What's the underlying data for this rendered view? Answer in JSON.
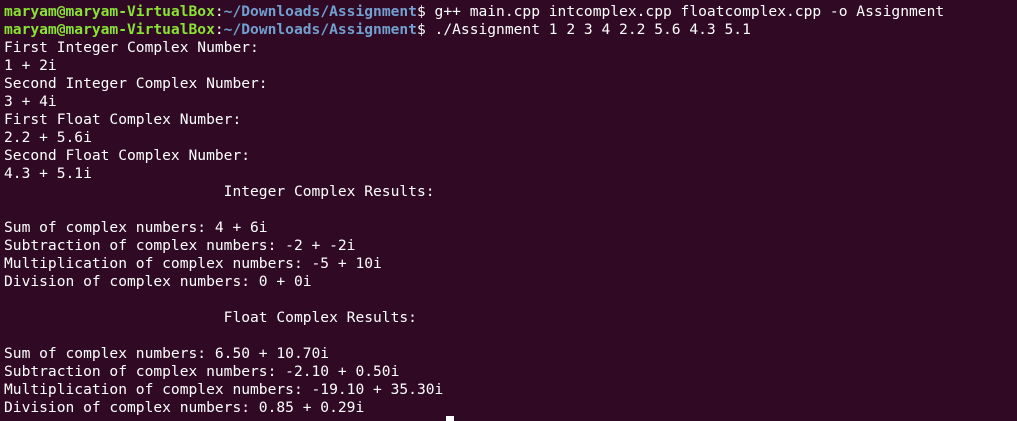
{
  "terminal": {
    "top_clip": "▪▪▪▪▪▪▪▪▪▪▪▪▪▪▪",
    "prompt_user": "maryam@maryam-VirtualBox",
    "prompt_sep": ":",
    "prompt_path": "~/Downloads/Assignment",
    "prompt_suffix": "$ ",
    "cmd1": "g++ main.cpp intcomplex.cpp floatcomplex.cpp -o Assignment",
    "cmd2": "./Assignment 1 2 3 4 2.2 5.6 4.3 5.1",
    "output": [
      "First Integer Complex Number:",
      "1 + 2i",
      "Second Integer Complex Number:",
      "3 + 4i",
      "First Float Complex Number:",
      "2.2 + 5.6i",
      "Second Float Complex Number:",
      "4.3 + 5.1i",
      "                         Integer Complex Results:",
      "",
      "Sum of complex numbers: 4 + 6i",
      "Subtraction of complex numbers: -2 + -2i",
      "Multiplication of complex numbers: -5 + 10i",
      "Division of complex numbers: 0 + 0i",
      "",
      "                         Float Complex Results:",
      "",
      "Sum of complex numbers: 6.50 + 10.70i",
      "Subtraction of complex numbers: -2.10 + 0.50i",
      "Multiplication of complex numbers: -19.10 + 35.30i",
      "Division of complex numbers: 0.85 + 0.29i"
    ],
    "colors": {
      "background": "#300a24",
      "text": "#ffffff",
      "user": "#8ae234",
      "path": "#729fcf"
    }
  }
}
